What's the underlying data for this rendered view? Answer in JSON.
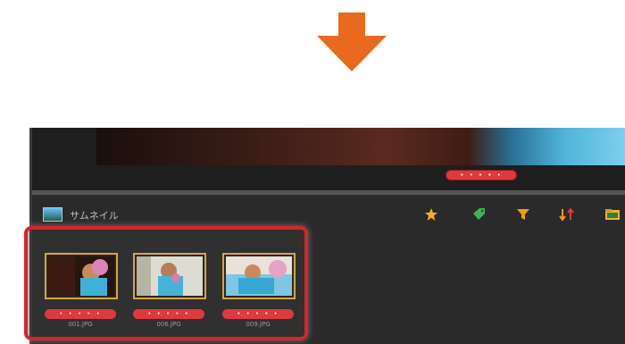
{
  "colors": {
    "arrow": "#e96a1f",
    "highlight": "#d9232d",
    "rating_pill": "#e0393d",
    "thumb_border": "#d7a545",
    "panel_bg": "#2a2a2a"
  },
  "preview": {
    "rating_label": "• • • • •"
  },
  "panel": {
    "title": "サムネイル",
    "icon": "thumbnail-panel-icon"
  },
  "toolbar": {
    "icons": [
      "star-icon",
      "tag-icon",
      "filter-icon",
      "sort-icon",
      "folder-icon"
    ]
  },
  "thumbnails": [
    {
      "name": "001.JPG",
      "rating_label": "• • • • •"
    },
    {
      "name": "006.JPG",
      "rating_label": "• • • • •"
    },
    {
      "name": "009.JPG",
      "rating_label": "• • • • •"
    }
  ]
}
